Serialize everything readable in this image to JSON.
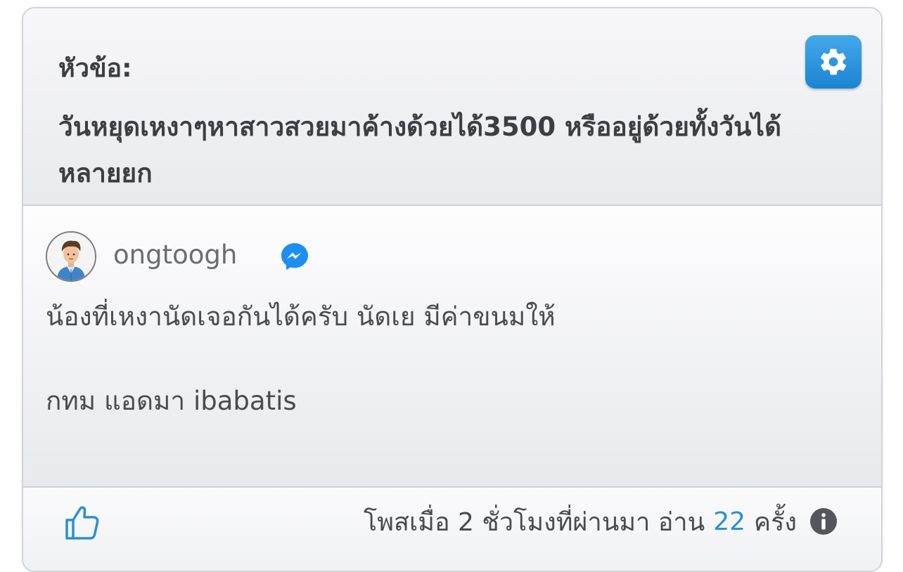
{
  "topic": {
    "label": "หัวข้อ:",
    "title": "วันหยุดเหงาๆหาสาวสวยมาค้างด้วยได้3500 หรืออยู่ด้วยทั้งวันได้ หลายยก"
  },
  "settings": {
    "icon": "gear-icon",
    "color": "#1b84d3"
  },
  "post": {
    "username": "ongtoogh",
    "messenger_icon": "messenger-icon",
    "message": "น้องที่เหงานัดเจอกันได้ครับ นัดเย มีค่าขนมให้\n\nกทม แอดมา ibabatis"
  },
  "footer": {
    "like_icon": "thumbs-up-icon",
    "posted_text": "โพสเมื่อ 2 ชั่วโมงที่ผ่านมา อ่าน",
    "read_count": "22",
    "times_text": "ครั้ง",
    "info_icon": "info-icon",
    "accent_color": "#2b8fd6"
  }
}
